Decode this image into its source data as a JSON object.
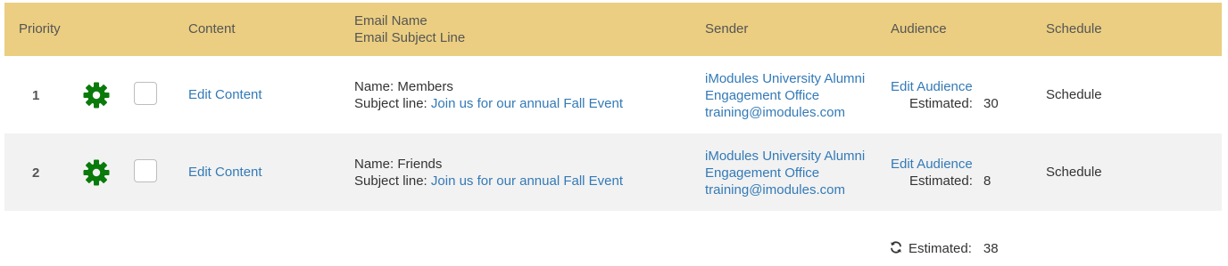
{
  "header": {
    "priority": "Priority",
    "content": "Content",
    "email_name": "Email Name",
    "email_subject": "Email Subject Line",
    "sender": "Sender",
    "audience": "Audience",
    "schedule": "Schedule"
  },
  "rows": [
    {
      "priority": "1",
      "content_link": "Edit Content",
      "name_label": "Name:",
      "name_value": "Members",
      "subject_label": "Subject line:",
      "subject_value": "Join us for our annual Fall Event",
      "sender_line1": "iModules University Alumni",
      "sender_line2": "Engagement Office",
      "sender_email": "training@imodules.com",
      "audience_link": "Edit Audience",
      "estimated_label": "Estimated:",
      "estimated_value": "30",
      "schedule": "Schedule"
    },
    {
      "priority": "2",
      "content_link": "Edit Content",
      "name_label": "Name:",
      "name_value": "Friends",
      "subject_label": "Subject line:",
      "subject_value": "Join us for our annual Fall Event",
      "sender_line1": "iModules University Alumni",
      "sender_line2": "Engagement Office",
      "sender_email": "training@imodules.com",
      "audience_link": "Edit Audience",
      "estimated_label": "Estimated:",
      "estimated_value": "8",
      "schedule": "Schedule"
    }
  ],
  "footer": {
    "estimated_label": "Estimated:",
    "estimated_total": "38",
    "icon": "refresh-icon"
  },
  "colors": {
    "header_bg": "#ebce81",
    "link": "#337ab7",
    "gear": "#0a7a0a",
    "alt_row": "#f2f2f2"
  }
}
